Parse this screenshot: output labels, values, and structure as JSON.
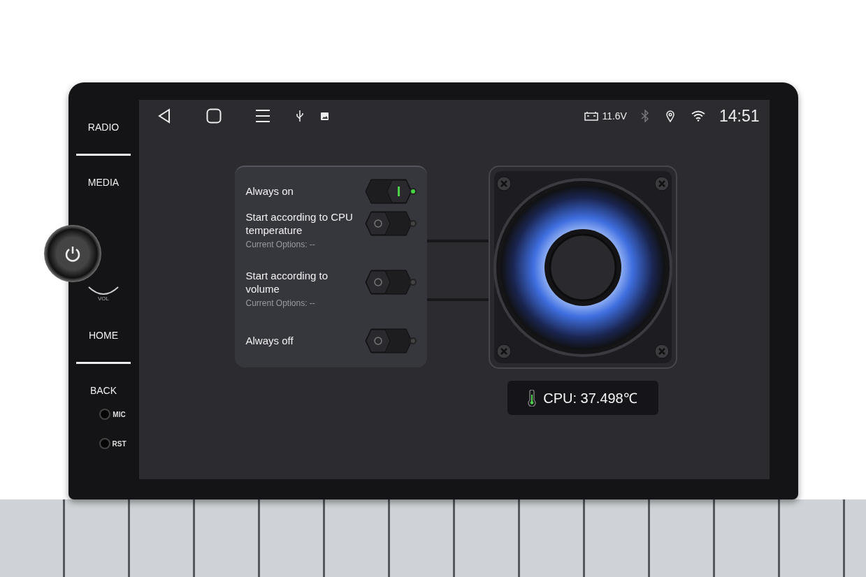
{
  "bezel": {
    "buttons": [
      "RADIO",
      "MEDIA",
      "HOME",
      "BACK"
    ],
    "knob_label": "VOL",
    "ports": [
      "MIC",
      "RST"
    ]
  },
  "status_bar": {
    "battery": "11.6V",
    "bluetooth_on": false,
    "time": "14:51"
  },
  "fan_modes": [
    {
      "label": "Always on",
      "on": true
    },
    {
      "label": "Start according to CPU temperature",
      "subtitle": "Current Options: --",
      "on": false
    },
    {
      "label": "Start according to volume",
      "subtitle": "Current Options: --",
      "on": false
    },
    {
      "label": "Always off",
      "on": false
    }
  ],
  "cpu": {
    "reading": "CPU: 37.498℃"
  }
}
